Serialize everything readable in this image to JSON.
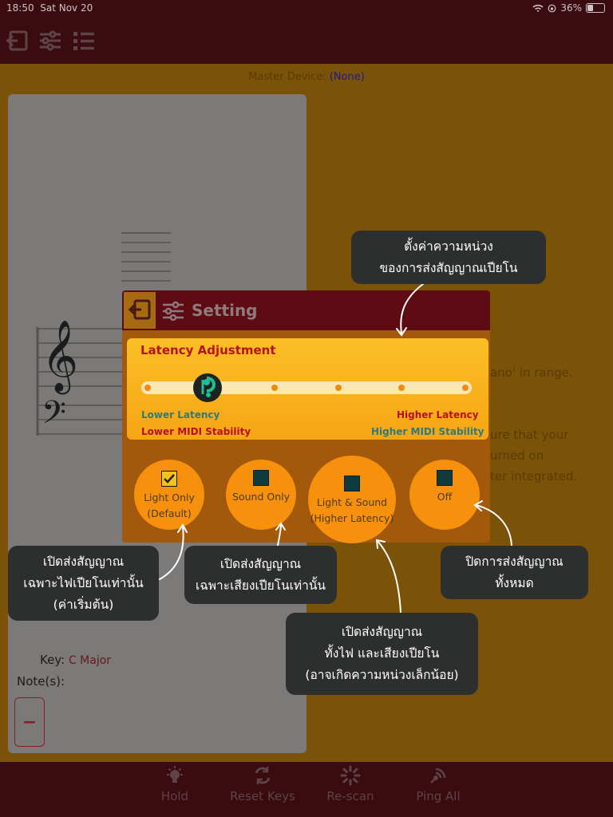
{
  "status_bar": {
    "time": "18:50",
    "date": "Sat Nov 20",
    "battery": "36%"
  },
  "master_device": {
    "label": "Master Device:",
    "value": "(None)"
  },
  "background_text": {
    "line1": "ano' in range.",
    "line2": "ure that your",
    "line3": "urned on",
    "line4": "ter integrated."
  },
  "key_panel": {
    "key_label": "Key:",
    "key_value": "C Major",
    "notes_label": "Note(s):",
    "minus_label": "−"
  },
  "dialog": {
    "title": "Setting",
    "latency": {
      "title": "Latency Adjustment",
      "left_top": "Lower Latency",
      "left_bottom": "Lower MIDI Stability",
      "right_top": "Higher Latency",
      "right_bottom": "Higher MIDI Stability",
      "steps": 6,
      "selected_step": 2
    },
    "options": [
      {
        "line1": "Light Only",
        "line2": "(Default)",
        "checked": true
      },
      {
        "line1": "Sound Only",
        "line2": "",
        "checked": false
      },
      {
        "line1": "Light & Sound",
        "line2": "(Higher Latency)",
        "checked": false
      },
      {
        "line1": "Off",
        "line2": "",
        "checked": false
      }
    ]
  },
  "callouts": {
    "latency": {
      "l1": "ตั้งค่าความหน่วง",
      "l2": "ของการส่งสัญญาณเปียโน"
    },
    "light_only": {
      "l1": "เปิดส่งสัญญาณ",
      "l2": "เฉพาะไฟเปียโนเท่านั้น",
      "l3": "(ค่าเริ่มต้น)"
    },
    "sound_only": {
      "l1": "เปิดส่งสัญญาณ",
      "l2": "เฉพาะเสียงเปียโนเท่านั้น"
    },
    "light_sound": {
      "l1": "เปิดส่งสัญญาณ",
      "l2": "ทั้งไฟ และเสียงเปียโน",
      "l3": "(อาจเกิดความหน่วงเล็กน้อย)"
    },
    "off": {
      "l1": "ปิดการส่งสัญญาณ",
      "l2": "ทั้งหมด"
    }
  },
  "bottom_bar": {
    "hold": "Hold",
    "reset_keys": "Reset Keys",
    "rescan": "Re-scan",
    "ping_all": "Ping All"
  },
  "colors": {
    "header": "#5e0b14",
    "dialog_body": "#a2590b",
    "option_circle": "#f7900d",
    "latency_title": "#b5121e",
    "callout": "#2d2f2f"
  }
}
